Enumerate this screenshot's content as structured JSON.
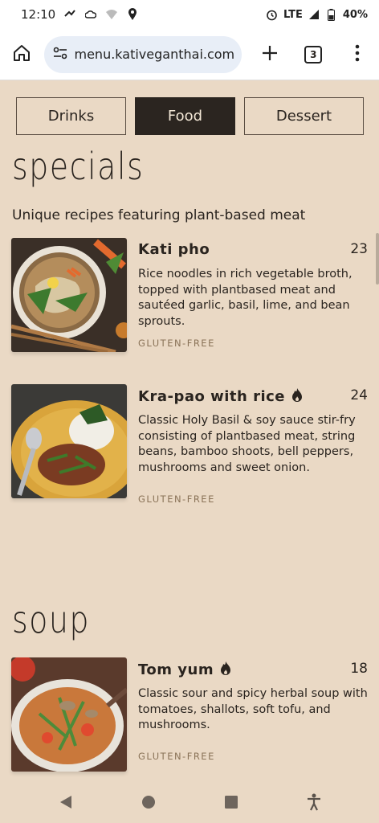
{
  "status": {
    "time": "12:10",
    "network": "LTE",
    "battery": "40%"
  },
  "browser": {
    "url": "menu.kativeganthai.com",
    "tab_count": "3"
  },
  "tabs": [
    {
      "label": "Drinks",
      "active": false
    },
    {
      "label": "Food",
      "active": true
    },
    {
      "label": "Dessert",
      "active": false
    }
  ],
  "sections": {
    "specials": {
      "title": "specials",
      "subtitle": "Unique recipes featuring plant-based meat",
      "items": [
        {
          "name": "Kati pho",
          "price": "23",
          "spicy": false,
          "description": "Rice noodles in rich vegetable broth, topped with plantbased meat and sautéed garlic, basil, lime, and bean sprouts.",
          "tag": "GLUTEN-FREE"
        },
        {
          "name": "Kra-pao with rice",
          "price": "24",
          "spicy": true,
          "description": "Classic Holy Basil & soy sauce stir-fry consisting of plantbased meat, string beans, bamboo shoots, bell peppers, mushrooms and sweet onion.",
          "tag": "GLUTEN-FREE"
        }
      ]
    },
    "soup": {
      "title": "soup",
      "items": [
        {
          "name": "Tom yum",
          "price": "18",
          "spicy": true,
          "description": "Classic sour and spicy herbal soup with tomatoes, shallots, soft tofu, and mushrooms.",
          "tag": "GLUTEN-FREE"
        }
      ]
    }
  },
  "icons": {
    "status": [
      "signal-icon",
      "cloud-icon",
      "wifi-icon",
      "location-icon",
      "alarm-icon",
      "battery-icon"
    ],
    "toolbar": [
      "home-icon",
      "site-settings-icon",
      "new-tab-icon",
      "tab-switcher-icon",
      "overflow-menu-icon"
    ],
    "nav": [
      "back-icon",
      "home-nav-icon",
      "recents-icon",
      "accessibility-icon"
    ],
    "spicy": "flame-icon"
  },
  "colors": {
    "background": "#ead9c5",
    "active_tab": "#2b2520",
    "tag": "#8a7358"
  }
}
